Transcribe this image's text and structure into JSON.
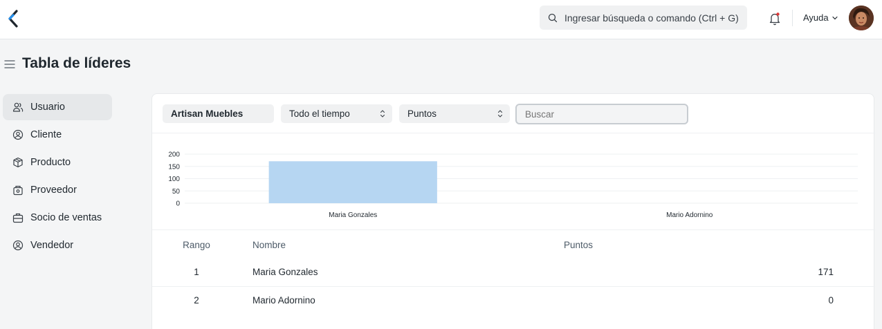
{
  "navbar": {
    "search_placeholder": "Ingresar búsqueda o comando (Ctrl + G)",
    "help_label": "Ayuda",
    "icons": {
      "logo": "frappe-logo",
      "search": "search-icon",
      "bell": "bell-icon",
      "chevron": "chevron-down-icon"
    },
    "notification_dot_color": "#e03636"
  },
  "page": {
    "title": "Tabla de líderes"
  },
  "sidebar": {
    "items": [
      {
        "label": "Usuario",
        "icon": "users-icon",
        "active": true
      },
      {
        "label": "Cliente",
        "icon": "customer-icon",
        "active": false
      },
      {
        "label": "Producto",
        "icon": "box-icon",
        "active": false
      },
      {
        "label": "Proveedor",
        "icon": "supplier-icon",
        "active": false
      },
      {
        "label": "Socio de ventas",
        "icon": "briefcase-icon",
        "active": false
      },
      {
        "label": "Vendedor",
        "icon": "user-circle-icon",
        "active": false
      }
    ]
  },
  "filters": {
    "company": "Artisan Muebles",
    "period": "Todo el tiempo",
    "field": "Puntos",
    "search_placeholder": "Buscar"
  },
  "chart_data": {
    "type": "bar",
    "categories": [
      "Maria Gonzales",
      "Mario Adornino"
    ],
    "values": [
      171,
      0
    ],
    "ylim": [
      0,
      200
    ],
    "yticks": [
      "0",
      "50",
      "100",
      "150",
      "200"
    ],
    "bar_color": "#b6d6f2",
    "grid": true
  },
  "table": {
    "headers": {
      "rank": "Rango",
      "name": "Nombre",
      "points": "Puntos"
    },
    "rows": [
      {
        "rank": "1",
        "name": "Maria Gonzales",
        "points": "171"
      },
      {
        "rank": "2",
        "name": "Mario Adornino",
        "points": "0"
      }
    ]
  }
}
